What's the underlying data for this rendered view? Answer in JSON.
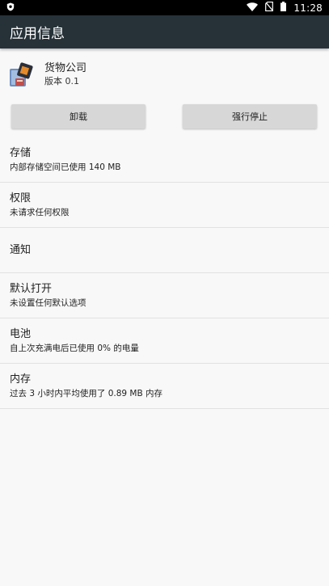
{
  "status_bar": {
    "time": "11:28",
    "icons": [
      "shield-icon",
      "wifi-icon",
      "no-sim-icon",
      "battery-icon"
    ]
  },
  "app_bar": {
    "title": "应用信息"
  },
  "app": {
    "name": "货物公司",
    "version": "版本 0.1"
  },
  "buttons": {
    "uninstall": "卸载",
    "force_stop": "强行停止"
  },
  "items": [
    {
      "title": "存储",
      "summary": "内部存储空间已使用 140 MB"
    },
    {
      "title": "权限",
      "summary": "未请求任何权限"
    },
    {
      "title": "通知",
      "summary": ""
    },
    {
      "title": "默认打开",
      "summary": "未设置任何默认选项"
    },
    {
      "title": "电池",
      "summary": "自上次充满电后已使用 0% 的电量"
    },
    {
      "title": "内存",
      "summary": "过去 3 小时内平均使用了 0.89 MB 内存"
    }
  ],
  "colors": {
    "app_bar": "#263238",
    "status_bar": "#000000",
    "background": "#f8f8f8",
    "button": "#d7d7d7"
  }
}
